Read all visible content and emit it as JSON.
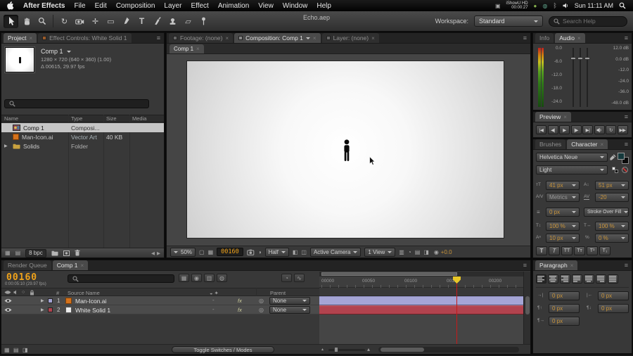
{
  "menubar": {
    "app_name": "After Effects",
    "items": [
      "File",
      "Edit",
      "Composition",
      "Layer",
      "Effect",
      "Animation",
      "View",
      "Window",
      "Help"
    ],
    "recorder_line1": "iShowU HD",
    "recorder_line2": "00:00:27",
    "clock": "Sun 11:11 AM"
  },
  "toolbar": {
    "doc_title": "Echo.aep",
    "workspace_label": "Workspace:",
    "workspace_value": "Standard",
    "search_placeholder": "Search Help"
  },
  "project": {
    "tab_project": "Project",
    "tab_effect_controls": "Effect Controls: White Solid 1",
    "comp_name": "Comp 1",
    "comp_info_line1": "1280 × 720 (640 × 360) (1.00)",
    "comp_info_line2": "Δ 00615, 29.97 fps",
    "columns": {
      "name": "Name",
      "type": "Type",
      "size": "Size",
      "media": "Media"
    },
    "rows": [
      {
        "name": "Comp 1",
        "type": "Composi...",
        "size": ""
      },
      {
        "name": "Man-Icon.ai",
        "type": "Vector Art",
        "size": "40 KB"
      },
      {
        "name": "Solids",
        "type": "Folder",
        "size": ""
      }
    ],
    "bpc_label": "8 bpc"
  },
  "viewer": {
    "tab_footage": "Footage: (none)",
    "tab_composition": "Composition: Comp 1",
    "tab_layer": "Layer: (none)",
    "comp_tab": "Comp 1",
    "magnification": "50%",
    "timecode": "00160",
    "resolution": "Half",
    "camera": "Active Camera",
    "view_layout": "1 View",
    "exposure": "+0.0"
  },
  "audio": {
    "tab_info": "Info",
    "tab_audio": "Audio",
    "meter_scale": [
      "0.0",
      "-6.0",
      "-12.0",
      "-18.0",
      "-24.0"
    ],
    "slider_scale": [
      "12.0 dB",
      "0.0 dB",
      "-12.0",
      "-24.0",
      "-36.0",
      "-48.0 dB"
    ]
  },
  "preview": {
    "title": "Preview"
  },
  "character": {
    "tab_brushes": "Brushes",
    "tab_character": "Character",
    "font_family": "Helvetica Neue",
    "font_style": "Light",
    "font_size": "41 px",
    "leading": "51 px",
    "kerning": "Metrics",
    "tracking": "-20",
    "stroke_width": "0 px",
    "stroke_mode": "Stroke Over Fill",
    "vertical_scale": "100 %",
    "horizontal_scale": "100 %",
    "baseline_shift": "10 px",
    "tsume": "0 %",
    "faux": [
      "T",
      "T",
      "TT",
      "Tт",
      "T¹",
      "T₁"
    ]
  },
  "paragraph": {
    "title": "Paragraph",
    "indent_left": "0 px",
    "indent_right": "0 px",
    "space_before": "0 px",
    "space_after": "0 px",
    "first_line_indent": "0 px"
  },
  "timeline": {
    "tab_render_queue": "Render Queue",
    "tab_comp": "Comp 1",
    "timecode": "00160",
    "timecode_detail": "0:00:05:10 (29.97 fps)",
    "col_source_name": "Source Name",
    "col_parent": "Parent",
    "layers": [
      {
        "index": "1",
        "name": "Man-Icon.ai",
        "parent": "None",
        "fx": "fx"
      },
      {
        "index": "2",
        "name": "White Solid 1",
        "parent": "None",
        "fx": "fx"
      }
    ],
    "ruler": [
      "00000",
      "00050",
      "00100",
      "00150",
      "00200"
    ],
    "toggle_button": "Toggle Switches / Modes"
  },
  "colors": {
    "value_orange": "#c9943a",
    "timecode_orange": "#efa21a",
    "layer1_bar": "#a5a5d5",
    "layer2_bar": "#b2434e",
    "cti_red": "#c41a1a",
    "selection_gray": "#c6c6c6"
  }
}
